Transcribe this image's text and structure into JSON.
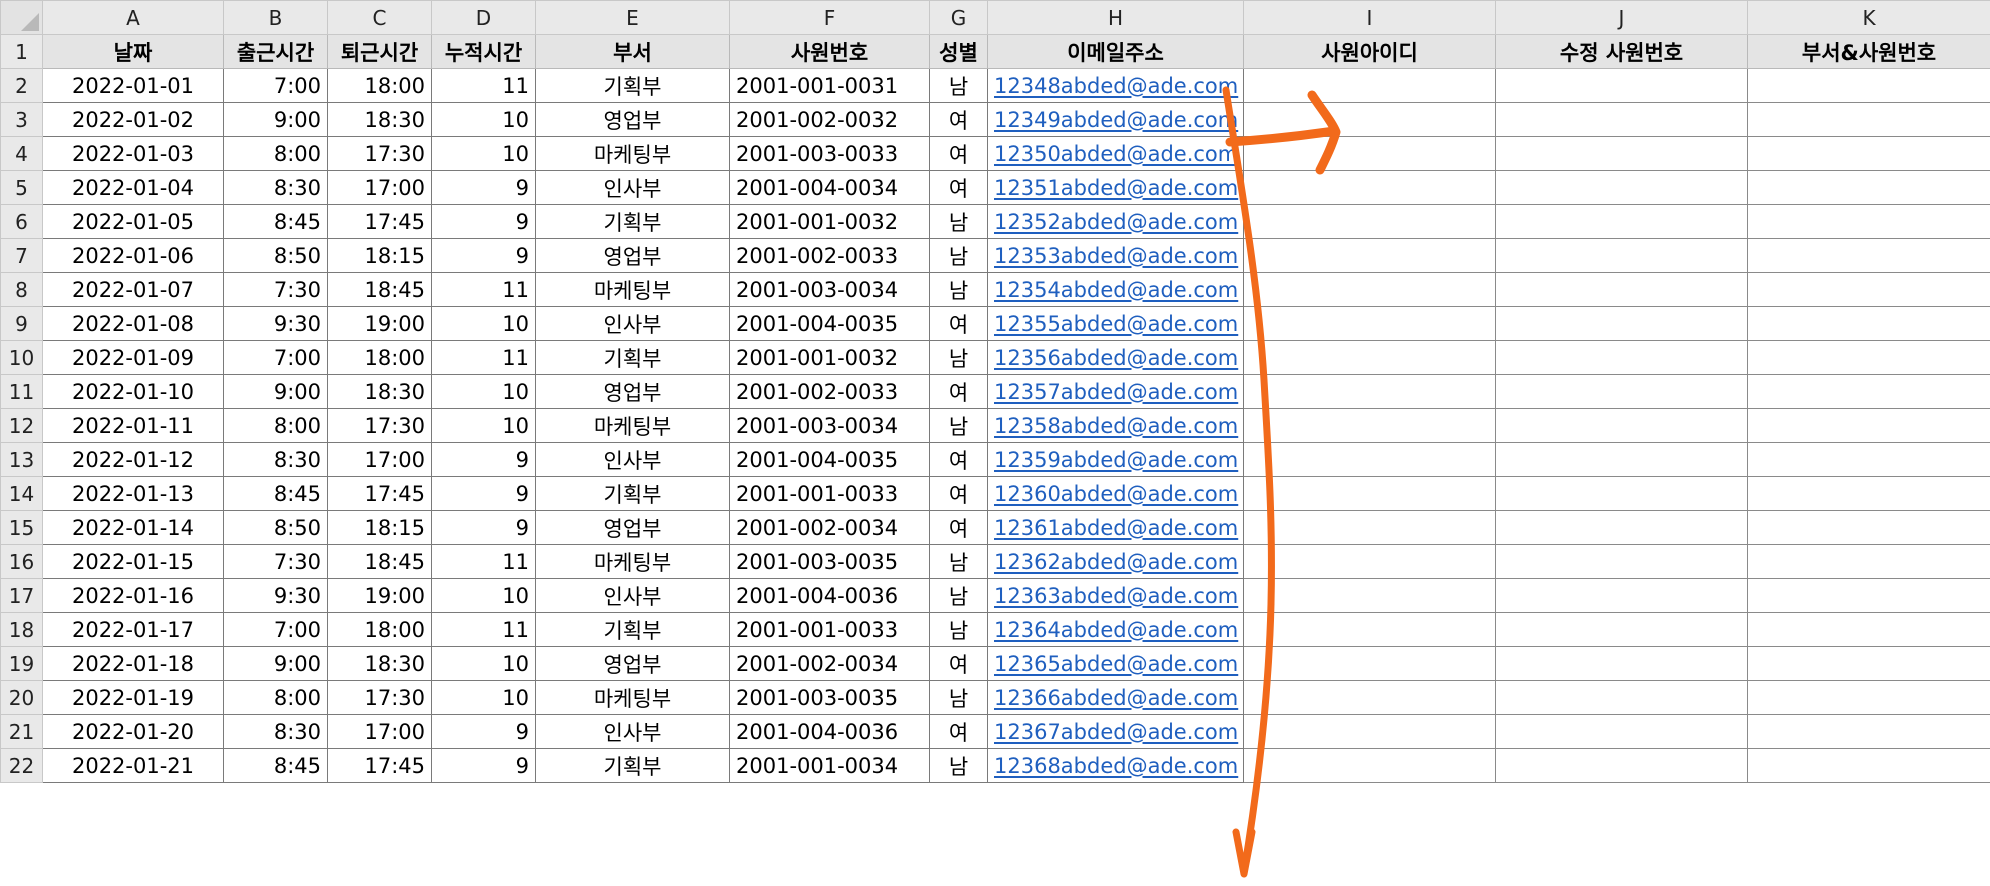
{
  "columns": [
    "A",
    "B",
    "C",
    "D",
    "E",
    "F",
    "G",
    "H",
    "I",
    "J",
    "K"
  ],
  "header_row": {
    "row_number": "1",
    "cells": [
      "날짜",
      "출근시간",
      "퇴근시간",
      "누적시간",
      "부서",
      "사원번호",
      "성별",
      "이메일주소",
      "사원아이디",
      "수정 사원번호",
      "부서&사원번호"
    ]
  },
  "rows": [
    {
      "row_number": "2",
      "date": "2022-01-01",
      "in": "7:00",
      "out": "18:00",
      "hours": "11",
      "dept": "기획부",
      "emp_no": "2001-001-0031",
      "gender": "남",
      "email": "12348abded@ade.com"
    },
    {
      "row_number": "3",
      "date": "2022-01-02",
      "in": "9:00",
      "out": "18:30",
      "hours": "10",
      "dept": "영업부",
      "emp_no": "2001-002-0032",
      "gender": "여",
      "email": "12349abded@ade.com"
    },
    {
      "row_number": "4",
      "date": "2022-01-03",
      "in": "8:00",
      "out": "17:30",
      "hours": "10",
      "dept": "마케팅부",
      "emp_no": "2001-003-0033",
      "gender": "여",
      "email": "12350abded@ade.com"
    },
    {
      "row_number": "5",
      "date": "2022-01-04",
      "in": "8:30",
      "out": "17:00",
      "hours": "9",
      "dept": "인사부",
      "emp_no": "2001-004-0034",
      "gender": "여",
      "email": "12351abded@ade.com"
    },
    {
      "row_number": "6",
      "date": "2022-01-05",
      "in": "8:45",
      "out": "17:45",
      "hours": "9",
      "dept": "기획부",
      "emp_no": "2001-001-0032",
      "gender": "남",
      "email": "12352abded@ade.com"
    },
    {
      "row_number": "7",
      "date": "2022-01-06",
      "in": "8:50",
      "out": "18:15",
      "hours": "9",
      "dept": "영업부",
      "emp_no": "2001-002-0033",
      "gender": "남",
      "email": "12353abded@ade.com"
    },
    {
      "row_number": "8",
      "date": "2022-01-07",
      "in": "7:30",
      "out": "18:45",
      "hours": "11",
      "dept": "마케팅부",
      "emp_no": "2001-003-0034",
      "gender": "남",
      "email": "12354abded@ade.com"
    },
    {
      "row_number": "9",
      "date": "2022-01-08",
      "in": "9:30",
      "out": "19:00",
      "hours": "10",
      "dept": "인사부",
      "emp_no": "2001-004-0035",
      "gender": "여",
      "email": "12355abded@ade.com"
    },
    {
      "row_number": "10",
      "date": "2022-01-09",
      "in": "7:00",
      "out": "18:00",
      "hours": "11",
      "dept": "기획부",
      "emp_no": "2001-001-0032",
      "gender": "남",
      "email": "12356abded@ade.com"
    },
    {
      "row_number": "11",
      "date": "2022-01-10",
      "in": "9:00",
      "out": "18:30",
      "hours": "10",
      "dept": "영업부",
      "emp_no": "2001-002-0033",
      "gender": "여",
      "email": "12357abded@ade.com"
    },
    {
      "row_number": "12",
      "date": "2022-01-11",
      "in": "8:00",
      "out": "17:30",
      "hours": "10",
      "dept": "마케팅부",
      "emp_no": "2001-003-0034",
      "gender": "남",
      "email": "12358abded@ade.com"
    },
    {
      "row_number": "13",
      "date": "2022-01-12",
      "in": "8:30",
      "out": "17:00",
      "hours": "9",
      "dept": "인사부",
      "emp_no": "2001-004-0035",
      "gender": "여",
      "email": "12359abded@ade.com"
    },
    {
      "row_number": "14",
      "date": "2022-01-13",
      "in": "8:45",
      "out": "17:45",
      "hours": "9",
      "dept": "기획부",
      "emp_no": "2001-001-0033",
      "gender": "여",
      "email": "12360abded@ade.com"
    },
    {
      "row_number": "15",
      "date": "2022-01-14",
      "in": "8:50",
      "out": "18:15",
      "hours": "9",
      "dept": "영업부",
      "emp_no": "2001-002-0034",
      "gender": "여",
      "email": "12361abded@ade.com"
    },
    {
      "row_number": "16",
      "date": "2022-01-15",
      "in": "7:30",
      "out": "18:45",
      "hours": "11",
      "dept": "마케팅부",
      "emp_no": "2001-003-0035",
      "gender": "남",
      "email": "12362abded@ade.com"
    },
    {
      "row_number": "17",
      "date": "2022-01-16",
      "in": "9:30",
      "out": "19:00",
      "hours": "10",
      "dept": "인사부",
      "emp_no": "2001-004-0036",
      "gender": "남",
      "email": "12363abded@ade.com"
    },
    {
      "row_number": "18",
      "date": "2022-01-17",
      "in": "7:00",
      "out": "18:00",
      "hours": "11",
      "dept": "기획부",
      "emp_no": "2001-001-0033",
      "gender": "남",
      "email": "12364abded@ade.com"
    },
    {
      "row_number": "19",
      "date": "2022-01-18",
      "in": "9:00",
      "out": "18:30",
      "hours": "10",
      "dept": "영업부",
      "emp_no": "2001-002-0034",
      "gender": "여",
      "email": "12365abded@ade.com"
    },
    {
      "row_number": "20",
      "date": "2022-01-19",
      "in": "8:00",
      "out": "17:30",
      "hours": "10",
      "dept": "마케팅부",
      "emp_no": "2001-003-0035",
      "gender": "남",
      "email": "12366abded@ade.com"
    },
    {
      "row_number": "21",
      "date": "2022-01-20",
      "in": "8:30",
      "out": "17:00",
      "hours": "9",
      "dept": "인사부",
      "emp_no": "2001-004-0036",
      "gender": "여",
      "email": "12367abded@ade.com"
    },
    {
      "row_number": "22",
      "date": "2022-01-21",
      "in": "8:45",
      "out": "17:45",
      "hours": "9",
      "dept": "기획부",
      "emp_no": "2001-001-0034",
      "gender": "남",
      "email": "12368abded@ade.com"
    }
  ],
  "colors": {
    "annotation_arrow": "#f26a1b",
    "link": "#1f5fbf",
    "header_fill": "#e4e4e4"
  }
}
